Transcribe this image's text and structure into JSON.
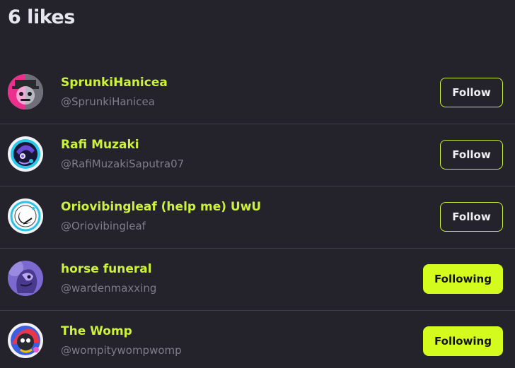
{
  "header": {
    "title": "6 likes"
  },
  "colors": {
    "background": "#24222b",
    "accent": "#ccf23a",
    "button_fill": "#d4fb1e",
    "divider": "#3f3d48",
    "handle": "#7f7d88"
  },
  "users": [
    {
      "name": "SprunkiHanicea",
      "handle": "@SprunkiHanicea",
      "button": "Follow",
      "state": "follow",
      "avatar_icon": "pink-character-avatar-icon"
    },
    {
      "name": "Rafi Muzaki",
      "handle": "@RafiMuzakiSaputra07",
      "button": "Follow",
      "state": "follow",
      "avatar_icon": "purple-character-avatar-icon"
    },
    {
      "name": "Oriovibingleaf (help me) UwU",
      "handle": "@Oriovibingleaf",
      "button": "Follow",
      "state": "follow",
      "avatar_icon": "moon-avatar-icon"
    },
    {
      "name": "horse funeral",
      "handle": "@wardenmaxxing",
      "button": "Following",
      "state": "following",
      "avatar_icon": "purple-creature-avatar-icon"
    },
    {
      "name": "The Womp",
      "handle": "@wompitywompwomp",
      "button": "Following",
      "state": "following",
      "avatar_icon": "colorful-character-avatar-icon"
    }
  ]
}
